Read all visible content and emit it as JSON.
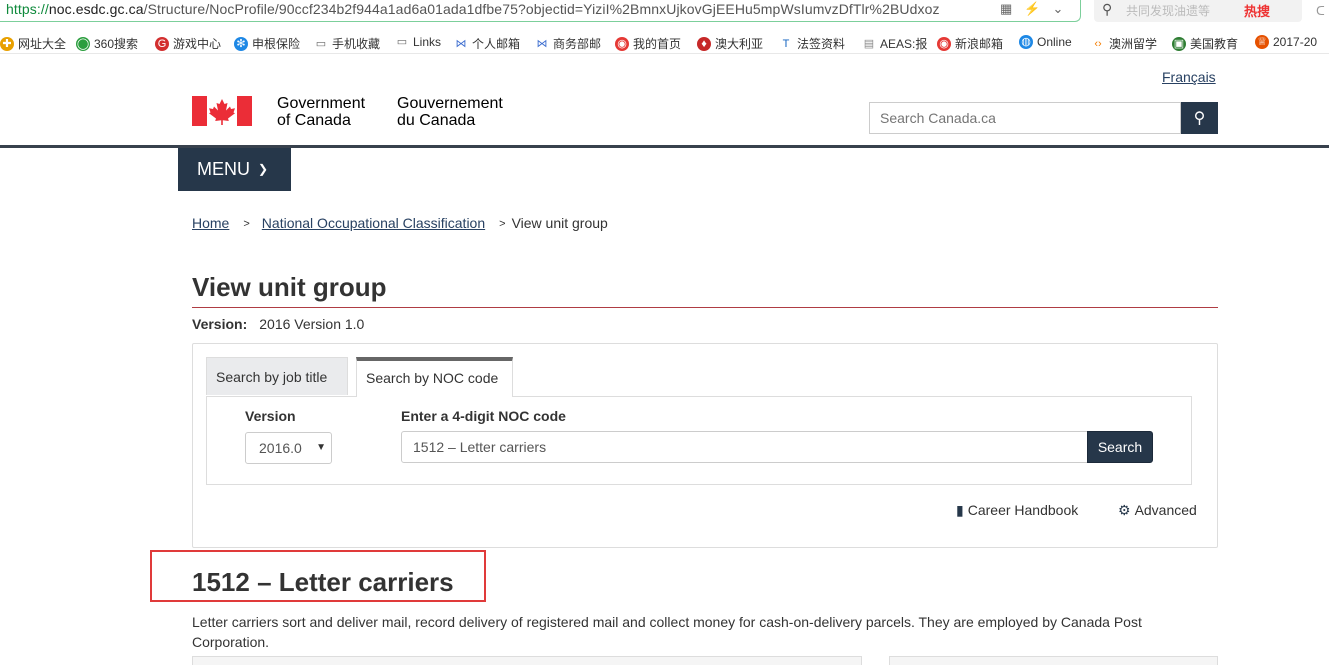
{
  "browser": {
    "url_scheme": "https://",
    "url_host": "noc.esdc.gc.ca",
    "url_path": "/Structure/NocProfile/90ccf234b2f944a1ad6a01ada1dfbe75?objectid=YiziI%2BmnxUjkovGjEEHu5mpWsIumvzDfTlr%2BUdxoz",
    "search_hint": "共同发现油遗等",
    "hot_label": "热搜",
    "bookmarks": [
      {
        "label": "网址大全",
        "icon": "home-icon",
        "color": "#e8a000"
      },
      {
        "label": "360搜索",
        "icon": "360-icon",
        "color": "#2b9e3e"
      },
      {
        "label": "游戏中心",
        "icon": "game-icon",
        "color": "#d32f2f"
      },
      {
        "label": "申根保险",
        "icon": "snowflake-icon",
        "color": "#1e88e5"
      },
      {
        "label": "手机收藏",
        "icon": "folder-icon",
        "color": "#666"
      },
      {
        "label": "Links",
        "icon": "folder-icon",
        "color": "#666"
      },
      {
        "label": "个人邮箱",
        "icon": "mail-icon",
        "color": "#3f6fd0"
      },
      {
        "label": "商务部邮",
        "icon": "mail-icon",
        "color": "#3f6fd0"
      },
      {
        "label": "我的首页",
        "icon": "weibo-icon",
        "color": "#e53935"
      },
      {
        "label": "澳大利亚",
        "icon": "flag-icon",
        "color": "#c62828"
      },
      {
        "label": "法签资料",
        "icon": "t-icon",
        "color": "#1565c0"
      },
      {
        "label": "AEAS:报",
        "icon": "doc-icon",
        "color": "#888"
      },
      {
        "label": "新浪邮箱",
        "icon": "weibo-icon",
        "color": "#e53935"
      },
      {
        "label": "Online",
        "icon": "globe-icon",
        "color": "#1e88e5"
      },
      {
        "label": "澳洲留学",
        "icon": "bracket-icon",
        "color": "#f57c00"
      },
      {
        "label": "美国教育",
        "icon": "edu-icon",
        "color": "#2e7d32"
      },
      {
        "label": "2017-20",
        "icon": "gift-icon",
        "color": "#e65100"
      }
    ]
  },
  "header": {
    "lang_link": "Français",
    "gov_en_line1": "Government",
    "gov_en_line2": "of Canada",
    "gov_fr_line1": "Gouvernement",
    "gov_fr_line2": "du Canada",
    "search_placeholder": "Search Canada.ca",
    "menu_label": "MENU"
  },
  "breadcrumb": {
    "items": [
      "Home",
      "National Occupational Classification"
    ],
    "current": "View unit group"
  },
  "page": {
    "title": "View unit group",
    "version_label": "Version:",
    "version_value": "2016 Version 1.0"
  },
  "search_panel": {
    "tabs": [
      "Search by job title",
      "Search by NOC code"
    ],
    "active_tab": 1,
    "version_label": "Version",
    "version_selected": "2016.0",
    "noc_label": "Enter a 4-digit NOC code",
    "noc_value": "1512 – Letter carriers",
    "search_button": "Search",
    "career_handbook": "Career Handbook",
    "advanced": "Advanced"
  },
  "result": {
    "title": "1512 – Letter carriers",
    "description": "Letter carriers sort and deliver mail, record delivery of registered mail and collect money for cash-on-delivery parcels. They are employed by Canada Post Corporation."
  },
  "colors": {
    "brand_navy": "#26374a",
    "title_rule": "#af3c43",
    "flag_red": "#eb2d37",
    "highlight_box": "#e03a3a"
  }
}
